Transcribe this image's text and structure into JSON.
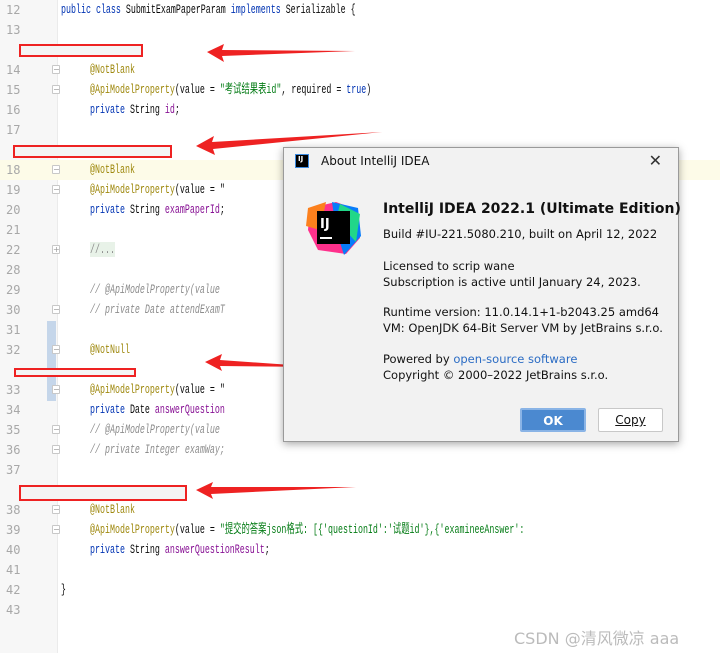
{
  "editor": {
    "lines": [
      {
        "n": "12",
        "html": "<span class='kw'>public class</span> SubmitExamPaperParam <span class='kw'>implements</span> Serializable {",
        "indent": 0
      },
      {
        "n": "13",
        "html": "",
        "indent": 0
      },
      {
        "n": "",
        "html": "",
        "indent": 0
      },
      {
        "n": "14",
        "html": "<span class='an'>@NotBlank</span>",
        "indent": 1,
        "fold": "-"
      },
      {
        "n": "15",
        "html": "<span class='an'>@ApiModelProperty</span>(value = <span class='st'>\"考试结果表id\"</span>, required = <span class='kw'>true</span>)",
        "indent": 1,
        "fold": "-"
      },
      {
        "n": "16",
        "html": "<span class='kw'>private</span> String <span class='fd'>id</span>;",
        "indent": 1
      },
      {
        "n": "17",
        "html": "",
        "indent": 0
      },
      {
        "n": "",
        "html": "",
        "indent": 0
      },
      {
        "n": "18",
        "html": "<span class='an'>@NotBlank</span>",
        "indent": 1,
        "fold": "-",
        "current": true
      },
      {
        "n": "19",
        "html": "<span class='an'>@ApiModelProperty</span>(value = \"",
        "indent": 1,
        "fold": "-"
      },
      {
        "n": "20",
        "html": "<span class='kw'>private</span> String <span class='fd'>examPaperId</span>;",
        "indent": 1
      },
      {
        "n": "21",
        "html": "",
        "indent": 0
      },
      {
        "n": "22",
        "html": "<span class='fc'>//...</span>",
        "indent": 1,
        "fold": "+"
      },
      {
        "n": "28",
        "html": "",
        "indent": 0
      },
      {
        "n": "29",
        "html": "<span class='cm'>// @ApiModelProperty(value</span>",
        "indent": 1
      },
      {
        "n": "30",
        "html": "<span class='cm'>// private Date attendExamT</span>",
        "indent": 1,
        "fold": "-"
      },
      {
        "n": "31",
        "html": "",
        "indent": 0
      },
      {
        "n": "32",
        "html": "<span class='an'>@NotNull</span>",
        "indent": 1,
        "fold": "-"
      },
      {
        "n": "",
        "html": "",
        "indent": 0
      },
      {
        "n": "33",
        "html": "<span class='an'>@ApiModelProperty</span>(value = \"",
        "indent": 1,
        "fold": "-"
      },
      {
        "n": "34",
        "html": "<span class='kw'>private</span> Date <span class='fd'>answerQuestion</span>",
        "indent": 1
      },
      {
        "n": "35",
        "html": "<span class='cm'>// @ApiModelProperty(value</span>",
        "indent": 1,
        "fold": "-"
      },
      {
        "n": "36",
        "html": "<span class='cm'>// private Integer examWay;</span>",
        "indent": 1,
        "fold": "-"
      },
      {
        "n": "37",
        "html": "",
        "indent": 0
      },
      {
        "n": "",
        "html": "",
        "indent": 0
      },
      {
        "n": "38",
        "html": "<span class='an'>@NotBlank</span>",
        "indent": 1,
        "fold": "-"
      },
      {
        "n": "39",
        "html": "<span class='an'>@ApiModelProperty</span>(value = <span class='st'>\"提交的答案json格式: [{'questionId':'试题id'},{'examineeAnswer':</span>",
        "indent": 1,
        "fold": "-"
      },
      {
        "n": "40",
        "html": "<span class='kw'>private</span> String <span class='fd'>answerQuestionResult</span>;",
        "indent": 1
      },
      {
        "n": "41",
        "html": "",
        "indent": 0
      },
      {
        "n": "42",
        "html": "}",
        "indent": 0
      },
      {
        "n": "43",
        "html": "",
        "indent": 0
      }
    ]
  },
  "dialog": {
    "title": "About IntelliJ IDEA",
    "logo_text": "IJ",
    "product": "IntelliJ IDEA 2022.1 (Ultimate Edition)",
    "build": "Build #IU-221.5080.210, built on April 12, 2022",
    "licensed": "Licensed to scrip wane",
    "subscription": "Subscription is active until January 24, 2023.",
    "runtime": "Runtime version: 11.0.14.1+1-b2043.25 amd64",
    "vm": "VM: OpenJDK 64-Bit Server VM by JetBrains s.r.o.",
    "powered_by": "Powered by",
    "powered_link": "open-source software",
    "copyright": "Copyright © 2000–2022 JetBrains s.r.o.",
    "ok_label": "OK",
    "copy_label": "Copy"
  },
  "watermark": "CSDN @清风微凉 aaa",
  "colors": {
    "annotation_red": "#ee2222",
    "ok_button": "#4b89d0",
    "link": "#2b6cc4"
  }
}
